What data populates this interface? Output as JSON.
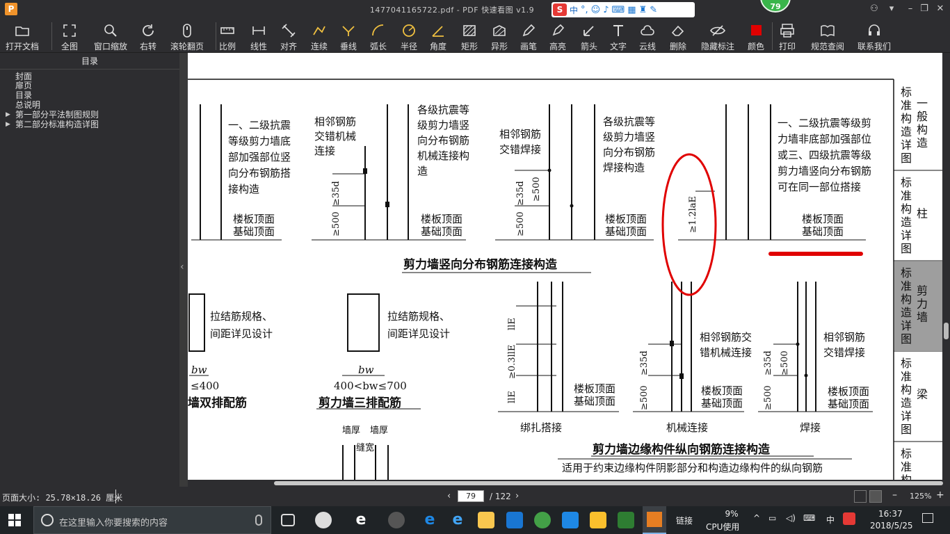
{
  "window": {
    "app_logo": "P",
    "title": "1477041165722.pdf - PDF 快速看图 v1.9",
    "badge": "79",
    "ime": {
      "letter": "S",
      "mode": "中"
    }
  },
  "toolbar": {
    "items": [
      {
        "id": "open",
        "label": "打开文档",
        "icon": "folder-icon"
      },
      {
        "id": "fit",
        "label": "全图",
        "icon": "fullscreen-icon"
      },
      {
        "id": "zoom-window",
        "label": "窗口缩放",
        "icon": "magnifier-icon"
      },
      {
        "id": "rotate",
        "label": "右转",
        "icon": "rotate-icon"
      },
      {
        "id": "scroll",
        "label": "滚轮翻页",
        "icon": "mouse-icon"
      },
      {
        "id": "scale",
        "label": "比例",
        "icon": "ruler-icon"
      },
      {
        "id": "linear",
        "label": "线性",
        "icon": "linear-dim-icon"
      },
      {
        "id": "aligned",
        "label": "对齐",
        "icon": "aligned-dim-icon"
      },
      {
        "id": "continuous",
        "label": "连续",
        "icon": "continuous-icon"
      },
      {
        "id": "perpendicular",
        "label": "垂线",
        "icon": "perpendicular-icon"
      },
      {
        "id": "arc",
        "label": "弧长",
        "icon": "arc-icon"
      },
      {
        "id": "radius",
        "label": "半径",
        "icon": "radius-icon"
      },
      {
        "id": "angle",
        "label": "角度",
        "icon": "angle-icon"
      },
      {
        "id": "rect",
        "label": "矩形",
        "icon": "rect-hatch-icon"
      },
      {
        "id": "polygon",
        "label": "异形",
        "icon": "polygon-icon"
      },
      {
        "id": "pen",
        "label": "画笔",
        "icon": "pen-icon"
      },
      {
        "id": "highlight",
        "label": "高亮",
        "icon": "highlighter-icon"
      },
      {
        "id": "arrow",
        "label": "箭头",
        "icon": "arrow-icon"
      },
      {
        "id": "text",
        "label": "文字",
        "icon": "text-icon"
      },
      {
        "id": "cloud",
        "label": "云线",
        "icon": "cloud-icon"
      },
      {
        "id": "erase",
        "label": "删除",
        "icon": "eraser-icon"
      },
      {
        "id": "hide",
        "label": "隐藏标注",
        "icon": "eye-off-icon"
      },
      {
        "id": "color",
        "label": "颜色",
        "icon": "color-swatch-icon"
      },
      {
        "id": "print",
        "label": "打印",
        "icon": "printer-icon"
      },
      {
        "id": "standards",
        "label": "规范查阅",
        "icon": "book-icon"
      },
      {
        "id": "contact",
        "label": "联系我们",
        "icon": "headset-icon"
      }
    ]
  },
  "sidebar": {
    "title": "目录",
    "items": [
      {
        "label": "封面",
        "expandable": false
      },
      {
        "label": "扉页",
        "expandable": false
      },
      {
        "label": "目录",
        "expandable": false
      },
      {
        "label": "总说明",
        "expandable": false
      },
      {
        "label": "第一部分平法制图规则",
        "expandable": true
      },
      {
        "label": "第二部分标准构造详图",
        "expandable": true
      }
    ]
  },
  "document": {
    "side_tabs": [
      {
        "left": "标准构造详图",
        "right": "一般构造"
      },
      {
        "left": "标准构造详图",
        "right": "柱"
      },
      {
        "left": "标准构造详图",
        "right": "剪力墙"
      },
      {
        "left": "标准构造详图",
        "right": "梁"
      },
      {
        "left": "标准构"
      }
    ],
    "top": {
      "note1": [
        "一、二级抗震",
        "等级剪力墙底",
        "部加强部位竖",
        "向分布钢筋搭",
        "接构造"
      ],
      "note2": [
        "相邻钢筋",
        "交错机械",
        "连接"
      ],
      "note3": [
        "各级抗震等",
        "级剪力墙竖",
        "向分布钢筋",
        "机械连接构",
        "造"
      ],
      "note4": [
        "相邻钢筋",
        "交错焊接"
      ],
      "note5": [
        "各级抗震等",
        "级剪力墙竖",
        "向分布钢筋",
        "焊接构造"
      ],
      "note6": [
        "一、二级抗震等级剪",
        "力墙非底部加强部位",
        "或三、四级抗震等级",
        "剪力墙竖向分布钢筋",
        "可在同一部位搭接"
      ],
      "floor": [
        "楼板顶面",
        "基础顶面"
      ],
      "dim_35d": "≥35d",
      "dim_500": "≥500",
      "dim_12lae": "≥1.2laE",
      "caption": "剪力墙竖向分布钢筋连接构造"
    },
    "bottom": {
      "tie_note": [
        "拉结筋规格、",
        "间距详见设计"
      ],
      "bw": "bw",
      "bw_range1": "≤400",
      "bw_range2": "400<bw≤700",
      "cap_double": "墙双排配筋",
      "cap_triple": "剪力墙三排配筋",
      "lap_le": "llE",
      "lap_03": "≥0.3llE",
      "lap_caption": "绑扎搭接",
      "mech_note": [
        "相邻钢筋交",
        "错机械连接"
      ],
      "mech_caption": "机械连接",
      "weld_note": [
        "相邻钢筋",
        "交错焊接"
      ],
      "weld_caption": "焊接",
      "floor": [
        "楼板顶面",
        "基础顶面"
      ],
      "dim_35d": "≥35d",
      "dim_500": "≥500",
      "caption": "剪力墙边缘构件纵向钢筋连接构造",
      "subcaption": "适用于约束边缘构件阴影部分和构造边缘构件的纵向钢筋",
      "wall_thick": "墙厚",
      "gap_width": "缝宽"
    },
    "markup_color": "#e00000"
  },
  "status": {
    "page_size": "页面大小: 25.78×18.26 厘米",
    "current_page": "79",
    "total_pages": "/ 122",
    "zoom": "125%"
  },
  "taskbar": {
    "search_placeholder": "在这里输入你要搜索的内容",
    "tray_link": "链接",
    "cpu": "9%",
    "cpu_label": "CPU使用",
    "ime": "中",
    "time": "16:37",
    "date": "2018/5/25"
  }
}
